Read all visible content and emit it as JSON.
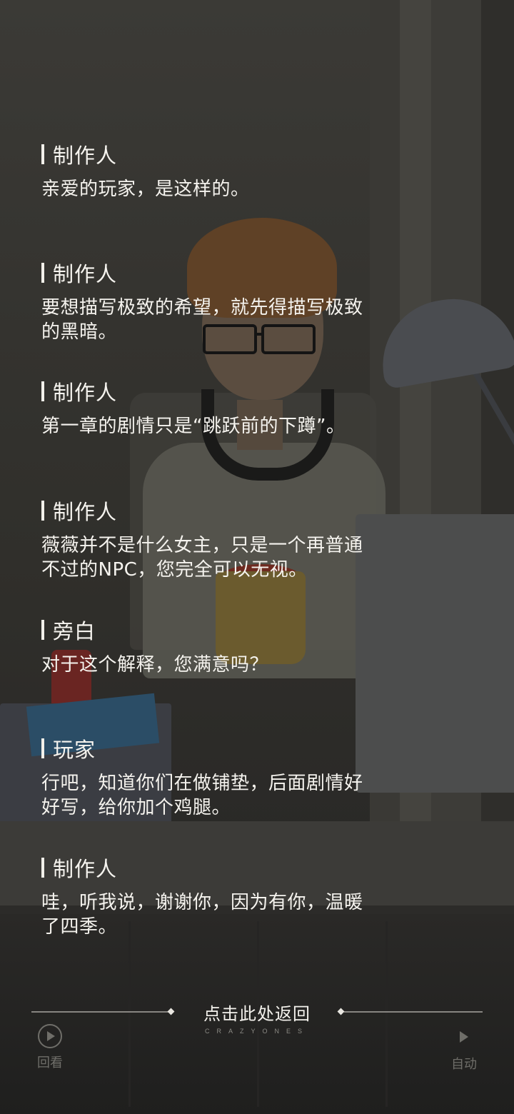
{
  "entries": [
    {
      "speaker": "制作人",
      "text": "亲爱的玩家，是这样的。"
    },
    {
      "speaker": "制作人",
      "text": "要想描写极致的希望，就先得描写极致\n的黑暗。"
    },
    {
      "speaker": "制作人",
      "text": "第一章的剧情只是“跳跃前的下蹲”。"
    },
    {
      "speaker": "制作人",
      "text": "薇薇并不是什么女主，只是一个再普通\n不过的NPC，您完全可以无视。"
    },
    {
      "speaker": "旁白",
      "text": "对于这个解释，您满意吗？"
    },
    {
      "speaker": "玩家",
      "text": "行吧，知道你们在做铺垫，后面剧情好\n好写，给你加个鸡腿。"
    },
    {
      "speaker": "制作人",
      "text": "哇，听我说，谢谢你，因为有你，温暖\n了四季。"
    }
  ],
  "controls": {
    "return_label": "点击此处返回",
    "brand": "CRAZYONES",
    "review_label": "回看",
    "auto_label": "自动"
  },
  "icons": {
    "review": "replay-icon",
    "auto": "play-icon"
  },
  "colors": {
    "text": "#f5f3ee",
    "muted": "#6f6e69"
  }
}
